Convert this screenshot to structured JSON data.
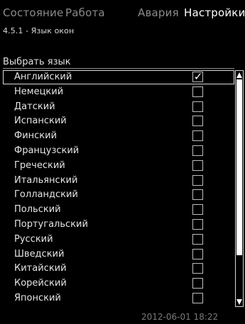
{
  "tabs": [
    {
      "label": "Состояние",
      "active": false
    },
    {
      "label": "Работа",
      "active": false
    },
    {
      "label": "Авария",
      "active": false
    },
    {
      "label": "Настройки",
      "active": true
    }
  ],
  "breadcrumb": "4.5.1 - Язык окон",
  "section_title": "Выбрать язык",
  "languages": [
    {
      "label": "Английский",
      "checked": true,
      "selected": true
    },
    {
      "label": "Немецкий",
      "checked": false
    },
    {
      "label": "Датский",
      "checked": false
    },
    {
      "label": "Испанский",
      "checked": false
    },
    {
      "label": "Финский",
      "checked": false
    },
    {
      "label": "Французский",
      "checked": false
    },
    {
      "label": "Греческий",
      "checked": false
    },
    {
      "label": "Итальянский",
      "checked": false
    },
    {
      "label": "Голландский",
      "checked": false
    },
    {
      "label": "Польский",
      "checked": false
    },
    {
      "label": "Португальский",
      "checked": false
    },
    {
      "label": "Русский",
      "checked": false
    },
    {
      "label": "Шведский",
      "checked": false
    },
    {
      "label": "Китайский",
      "checked": false
    },
    {
      "label": "Корейский",
      "checked": false
    },
    {
      "label": "Японский",
      "checked": false
    }
  ],
  "checkmark_glyph": "✓",
  "status": {
    "datetime": "2012-06-01 18:22"
  },
  "icons": {
    "scroll_up": "triangle-up-icon",
    "scroll_down": "triangle-down-icon"
  }
}
